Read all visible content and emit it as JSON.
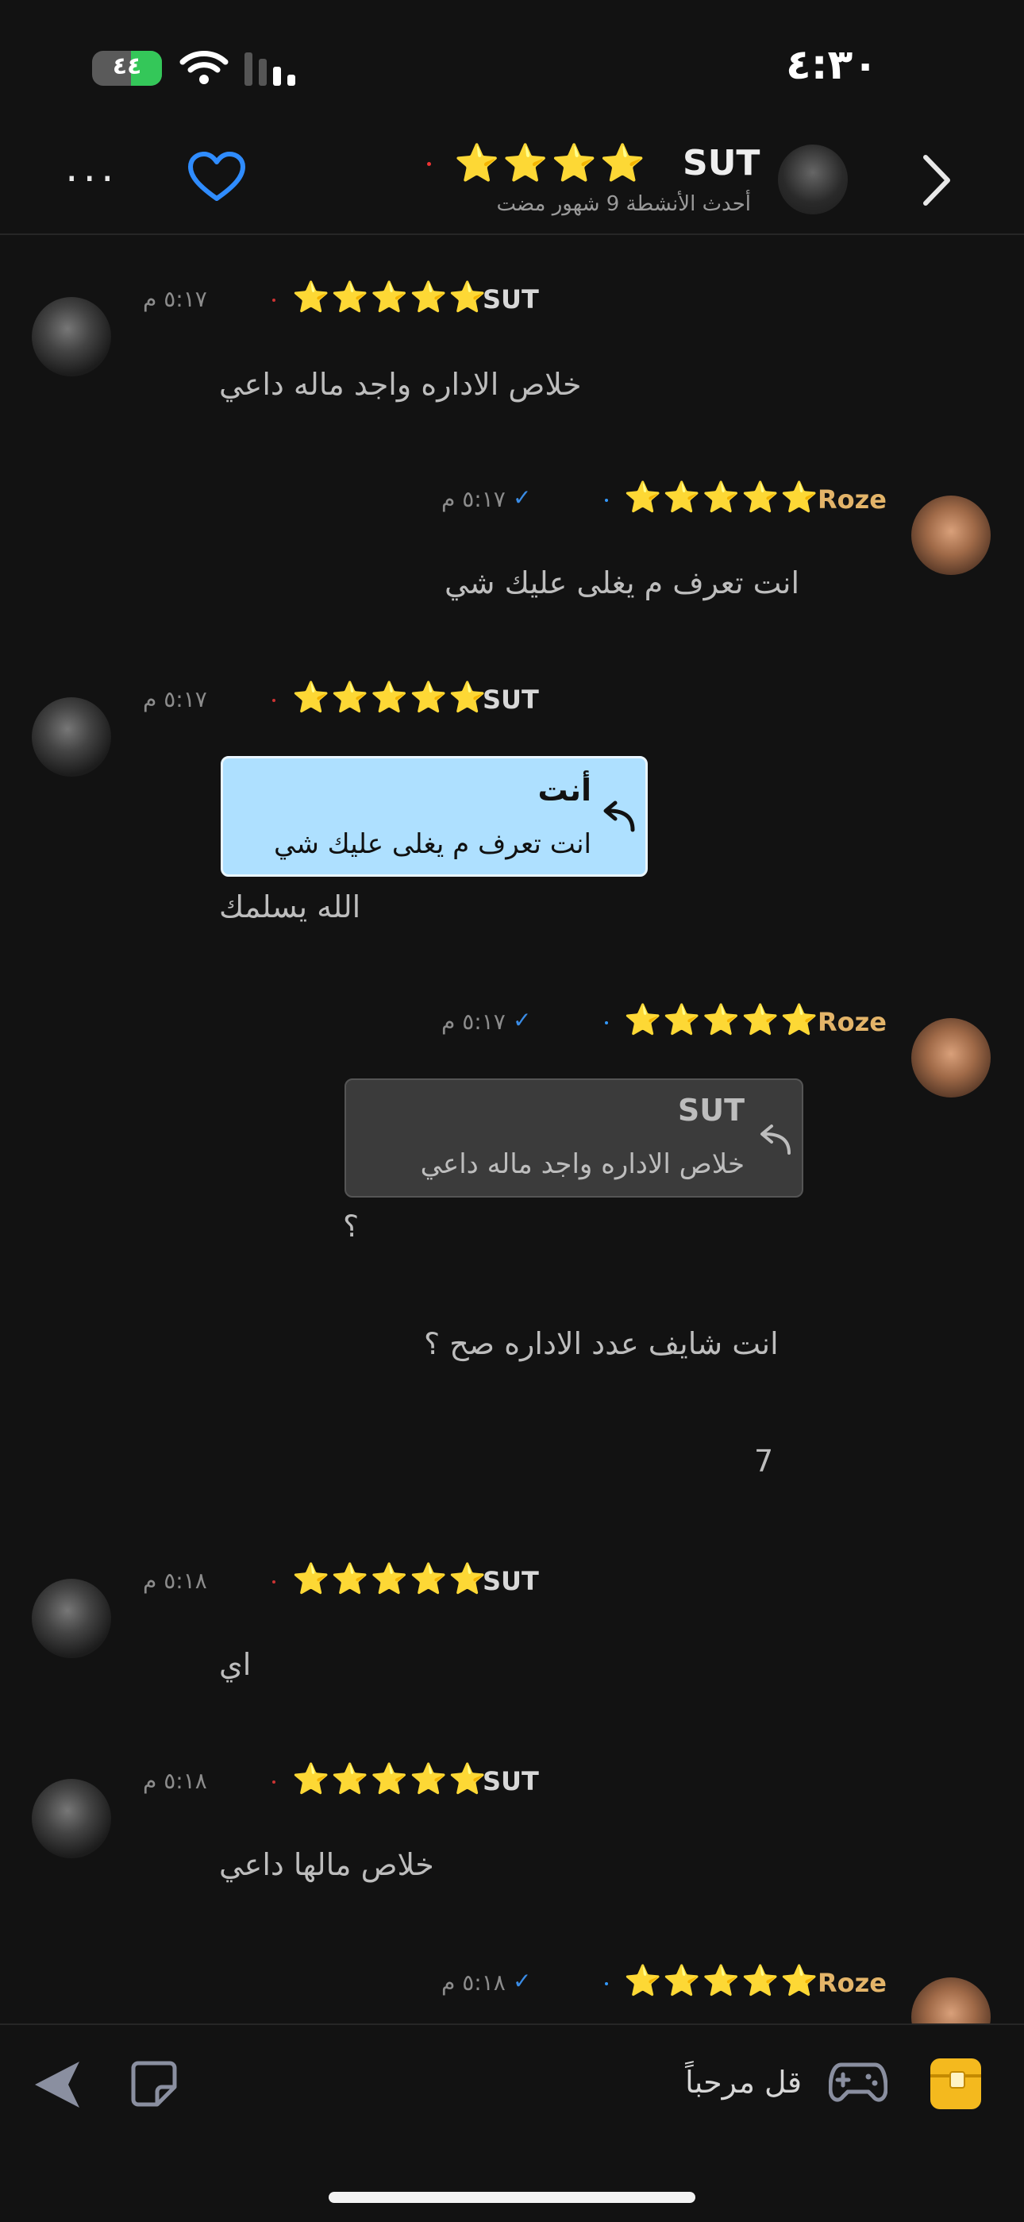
{
  "status_bar": {
    "time": "٤:٣٠",
    "battery": "٤٤",
    "battery_level_percent": 44
  },
  "header": {
    "name": "SUT",
    "stars": "⭐⭐⭐⭐",
    "subtitle": "أحدث الأنشطة 9 شهور مضت",
    "more_icon": "more-dots-icon",
    "favorite_icon": "heart-icon",
    "back_icon": "chevron-right-icon"
  },
  "messages": [
    {
      "sender": "SUT",
      "stars": "⭐⭐⭐⭐⭐",
      "time": "٥:١٧ م",
      "text": "خلاص الاداره واجد ماله داعي"
    },
    {
      "sender": "Roze",
      "stars": "⭐⭐⭐⭐⭐",
      "time": "٥:١٧ م",
      "text": "انت تعرف م يغلى عليك شي"
    },
    {
      "sender": "SUT",
      "stars": "⭐⭐⭐⭐⭐",
      "time": "٥:١٧ م",
      "quote": {
        "title": "أنت",
        "body": "انت تعرف م يغلى عليك شي"
      },
      "text": "الله يسلمك"
    },
    {
      "sender": "Roze",
      "stars": "⭐⭐⭐⭐⭐",
      "time": "٥:١٧ م",
      "quote": {
        "title": "SUT",
        "body": "خلاص الاداره واجد ماله داعي"
      },
      "text": "؟",
      "text2": "انت شايف عدد الاداره صح ؟",
      "text3": "7"
    },
    {
      "sender": "SUT",
      "stars": "⭐⭐⭐⭐⭐",
      "time": "٥:١٨ م",
      "text": "اي"
    },
    {
      "sender": "SUT",
      "stars": "⭐⭐⭐⭐⭐",
      "time": "٥:١٨ م",
      "text": "خلاص مالها داعي"
    },
    {
      "sender": "Roze",
      "stars": "⭐⭐⭐⭐⭐",
      "time": "٥:١٨ م"
    }
  ],
  "tick": "✓",
  "composer": {
    "placeholder": "قل مرحباً",
    "send_icon": "send-icon",
    "sticker_icon": "sticker-icon",
    "game_icon": "gamepad-icon",
    "treasure_icon": "treasure-chest-icon"
  },
  "colors": {
    "background": "#121212",
    "roze_name": "#e3b469",
    "tick": "#3a8ce6",
    "quote_blue": "#aee0ff",
    "favorite": "#2f8cff",
    "chest": "#f4b91e"
  }
}
